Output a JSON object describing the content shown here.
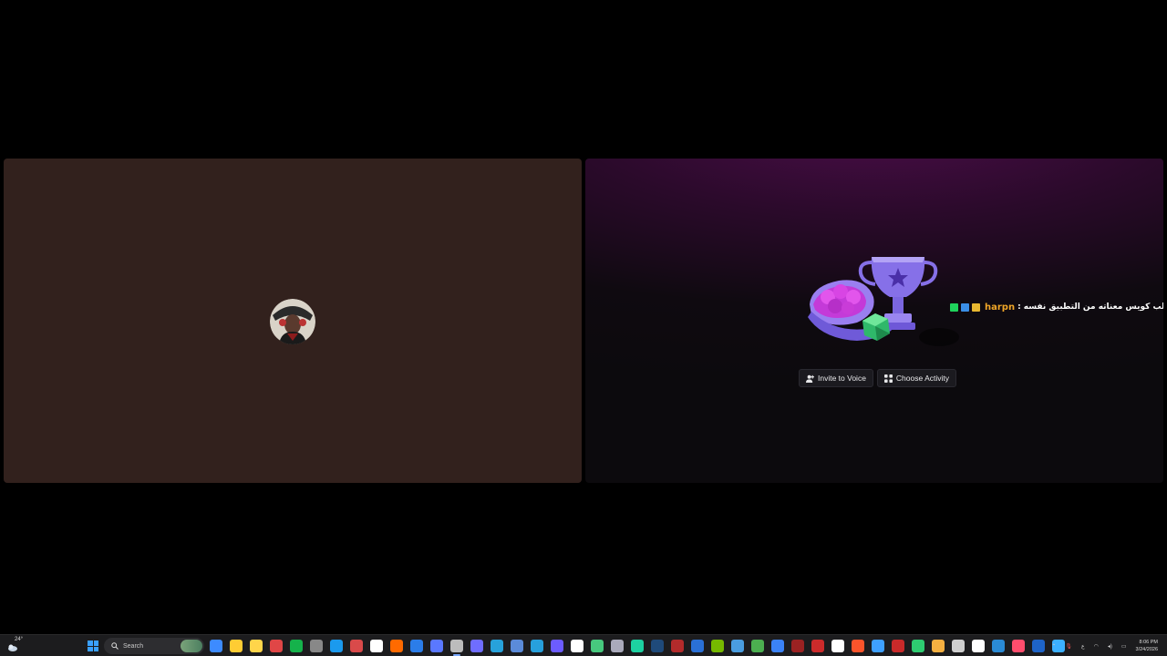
{
  "window_controls": {
    "minimize": "–",
    "maximize": "☐",
    "close": "✕"
  },
  "activity": {
    "user_name": "harpn",
    "status_text": "ﻋﻠﺐ ﻛﻮﻳﺲ ﻣﻌﻨﺎﺗﻪ ﻣﻦ ﺍﻟﺘﻄﺒﻴﻖ ﻧﻔﺴﻪ :",
    "invite_label": "Invite to Voice",
    "choose_label": "Choose Activity",
    "badge_colors": [
      "#1fd35c",
      "#3a8ee6",
      "#e8b730"
    ]
  },
  "taskbar": {
    "weather_temp": "24°",
    "search_label": "Search",
    "icon_colors": [
      "#3d8bff",
      "#ffcc33",
      "#ffd54a",
      "#e04646",
      "#15b24b",
      "#888888",
      "#1b9aee",
      "#d94a4a",
      "#ffffff",
      "#ff6a00",
      "#2b7de9",
      "#5a78ff",
      "#bcbcbc",
      "#6f6dff",
      "#27a2db",
      "#5b8bd9",
      "#27a0dc",
      "#6c5cff",
      "#ffffff",
      "#47c97e",
      "#aab",
      "#1dd1a1",
      "#1f4a7a",
      "#b32b2b",
      "#2a70d6",
      "#76b900",
      "#4a9de0",
      "#4caf50",
      "#3b82f6",
      "#9b2222",
      "#cc2b2b",
      "#ffffff",
      "#fb542b",
      "#3ea0ff",
      "#c92a2a",
      "#2ecc71",
      "#f5b041",
      "#cfcfcf",
      "#ffffff",
      "#2a8ad4",
      "#ff4d6d",
      "#1e64c8",
      "#3cb0ff"
    ],
    "tray_lang": "ع",
    "time": "8:06 PM",
    "date": "3/24/2026"
  }
}
